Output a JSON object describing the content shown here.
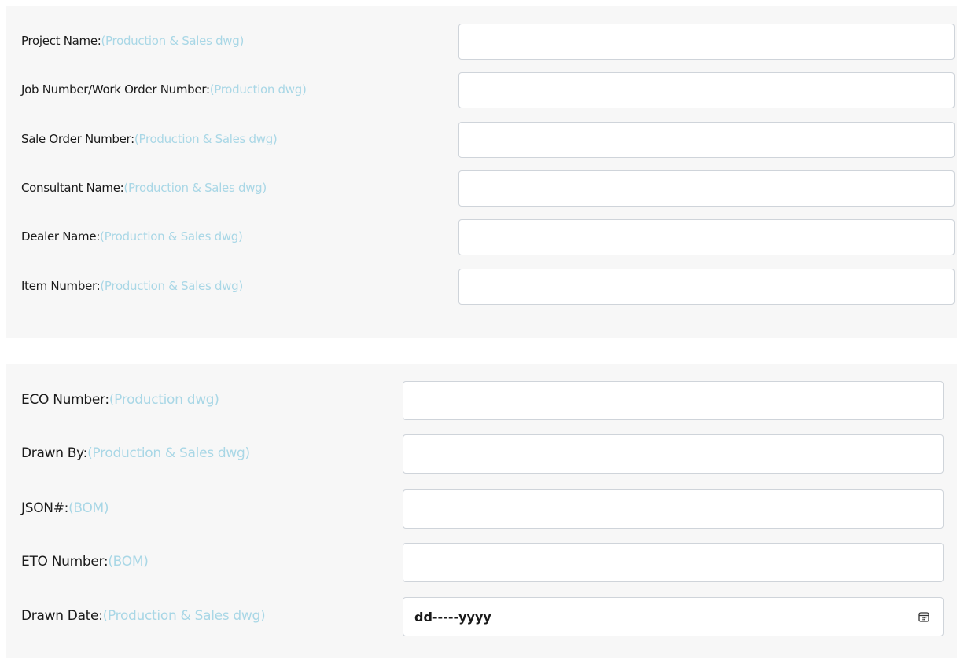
{
  "section_1": {
    "rows": [
      {
        "label": "Project Name:",
        "note": "(Production & Sales dwg)",
        "value": ""
      },
      {
        "label": "Job Number/Work Order Number:",
        "note": "(Production dwg)",
        "value": ""
      },
      {
        "label": "Sale Order Number:",
        "note": "(Production & Sales dwg)",
        "value": ""
      },
      {
        "label": "Consultant Name:",
        "note": "(Production & Sales dwg)",
        "value": ""
      },
      {
        "label": "Dealer Name:",
        "note": "(Production & Sales dwg)",
        "value": ""
      },
      {
        "label": "Item Number:",
        "note": "(Production & Sales dwg)",
        "value": ""
      }
    ]
  },
  "section_2": {
    "rows": [
      {
        "label": "ECO Number:",
        "note": "(Production dwg)",
        "value": ""
      },
      {
        "label": "Drawn By:",
        "note": "(Production & Sales dwg)",
        "value": ""
      },
      {
        "label": "JSON#:",
        "note": "(BOM)",
        "value": ""
      },
      {
        "label": "ETO Number:",
        "note": "(BOM)",
        "value": ""
      },
      {
        "label": "Drawn Date:",
        "note": "(Production & Sales dwg)",
        "value": "dd-----yyyy"
      }
    ]
  },
  "colors": {
    "label": "#1a1a1a",
    "note": "#a9d7e6",
    "panel_bg": "#f7f7f7",
    "field_border": "#cfd4da"
  },
  "icons": {
    "date_picker": "calendar-icon"
  }
}
